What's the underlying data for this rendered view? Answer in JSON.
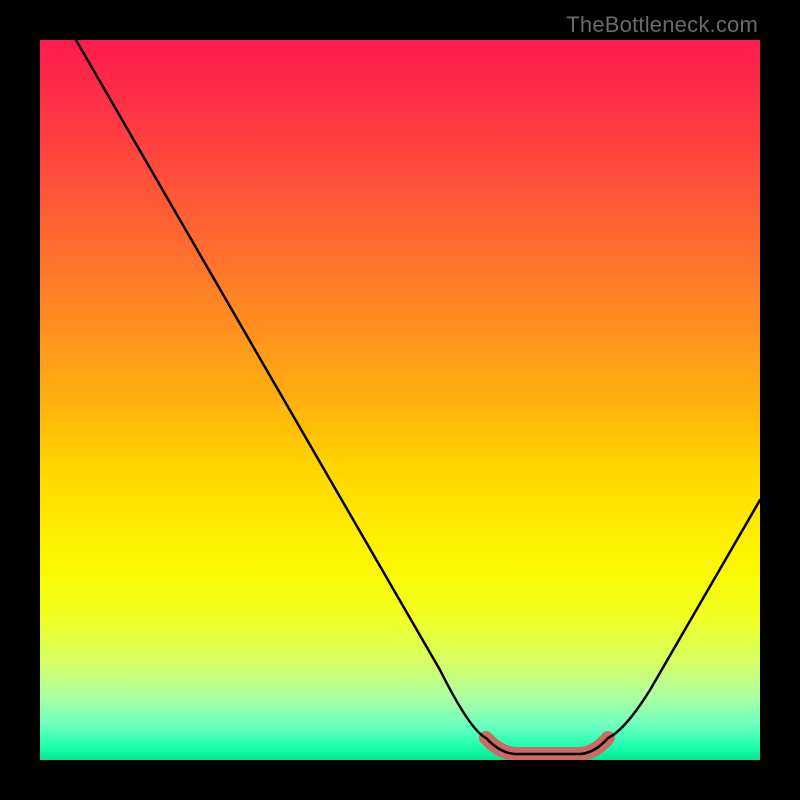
{
  "credit": "TheBottleneck.com",
  "colors": {
    "page_bg": "#000000",
    "curve": "#000000",
    "trough_highlight": "#cc6b66"
  },
  "chart_data": {
    "type": "line",
    "title": "",
    "xlabel": "",
    "ylabel": "",
    "xlim": [
      0,
      100
    ],
    "ylim": [
      0,
      100
    ],
    "x": [
      5,
      10,
      15,
      20,
      25,
      30,
      35,
      40,
      45,
      50,
      55,
      60,
      62,
      65,
      70,
      75,
      78,
      80,
      85,
      90,
      95,
      100
    ],
    "values": [
      100,
      91,
      82,
      73,
      64,
      55,
      46,
      37,
      29,
      21,
      13,
      6,
      3,
      1,
      0,
      0,
      1,
      3,
      10,
      18,
      27,
      36
    ],
    "trough_range_x": [
      62,
      78
    ],
    "grid": false,
    "legend": false,
    "background_gradient": [
      "#ff1a4d",
      "#ffd000",
      "#fbf800",
      "#00e890"
    ]
  }
}
